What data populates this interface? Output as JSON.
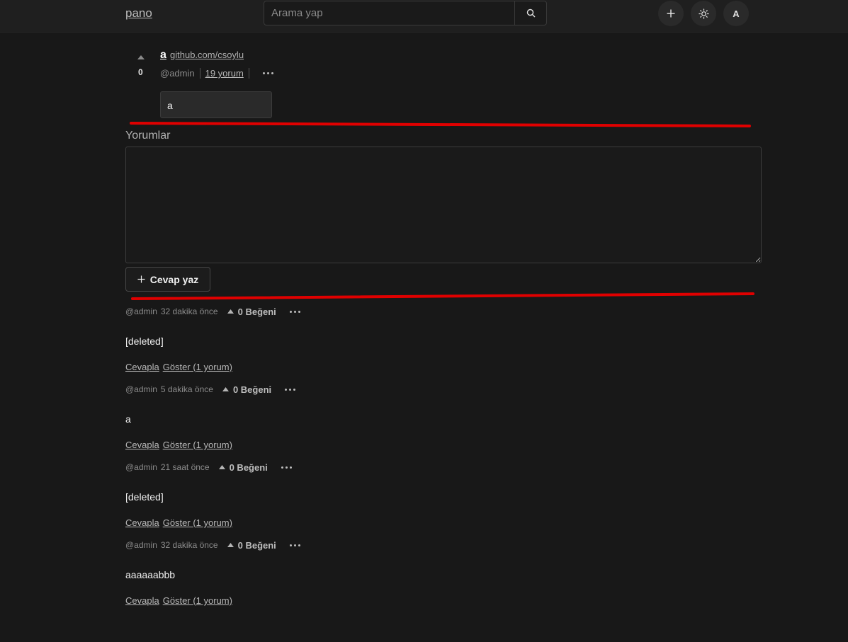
{
  "header": {
    "logo": "pano",
    "search_placeholder": "Arama yap",
    "avatar_letter": "A"
  },
  "post": {
    "votes": "0",
    "title": "a",
    "link": "github.com/csoylu",
    "author": "@admin",
    "comment_count_label": "19 yorum",
    "body": "a"
  },
  "comments_section": {
    "heading": "Yorumlar",
    "textarea_value": "",
    "reply_button_label": "Cevap yaz"
  },
  "comments": [
    {
      "author": "@admin",
      "time": "32 dakika önce",
      "likes": "0 Beğeni",
      "text": "[deleted]",
      "reply": "Cevapla",
      "show": "Göster (1 yorum)"
    },
    {
      "author": "@admin",
      "time": "5 dakika önce",
      "likes": "0 Beğeni",
      "text": "a",
      "reply": "Cevapla",
      "show": "Göster (1 yorum)"
    },
    {
      "author": "@admin",
      "time": "21 saat önce",
      "likes": "0 Beğeni",
      "text": "[deleted]",
      "reply": "Cevapla",
      "show": "Göster (1 yorum)"
    },
    {
      "author": "@admin",
      "time": "32 dakika önce",
      "likes": "0 Beğeni",
      "text": "aaaaaabbb",
      "reply": "Cevapla",
      "show": "Göster (1 yorum)"
    }
  ],
  "colors": {
    "background": "#181818",
    "header": "#1f1f1f",
    "annotation": "#e00000"
  },
  "icons": [
    "search-icon",
    "plus-icon",
    "sun-icon",
    "upvote-icon",
    "more-icon"
  ]
}
